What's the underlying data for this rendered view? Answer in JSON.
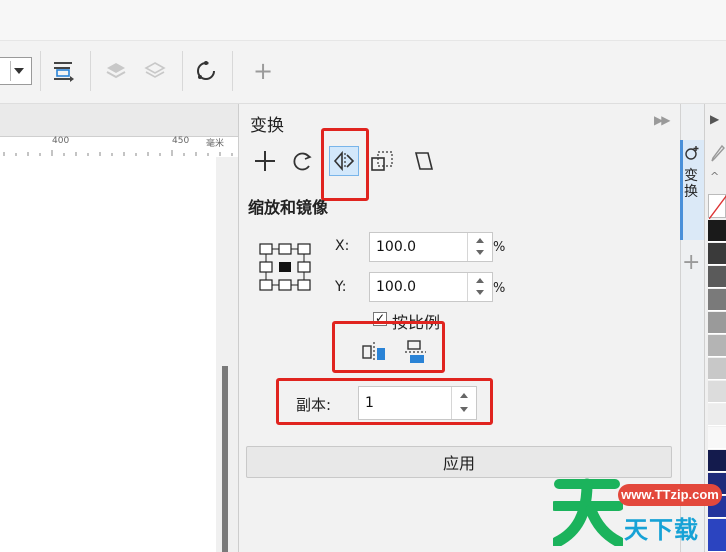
{
  "toolbar": {
    "icons": [
      "dropdown",
      "align-distribute-icon",
      "layers-icon",
      "layers-outline-icon",
      "refresh-outline-icon",
      "add-icon"
    ]
  },
  "ruler": {
    "tick_labels": [
      "400",
      "450"
    ],
    "unit": "毫米"
  },
  "docker": {
    "title": "变换",
    "modes": [
      "position-icon",
      "rotate-icon",
      "scale-mirror-icon",
      "size-icon",
      "skew-icon"
    ],
    "active_mode": "scale-mirror-icon",
    "section_title": "缩放和镜像",
    "x_label": "X:",
    "x_value": "100.0",
    "y_label": "Y:",
    "y_value": "100.0",
    "unit": "%",
    "proportional_checked": true,
    "proportional_label": "按比例",
    "mirror_buttons": [
      "mirror-horizontal-icon",
      "mirror-vertical-icon"
    ],
    "copies_label": "副本:",
    "copies_value": "1",
    "apply_label": "应用"
  },
  "side_tab": {
    "label": "变换"
  },
  "watermark": {
    "url": "www.TTzip.com",
    "text": "天下载"
  },
  "colors": {
    "highlight_red": "#e0241f",
    "accent_blue": "#4a90d9"
  }
}
